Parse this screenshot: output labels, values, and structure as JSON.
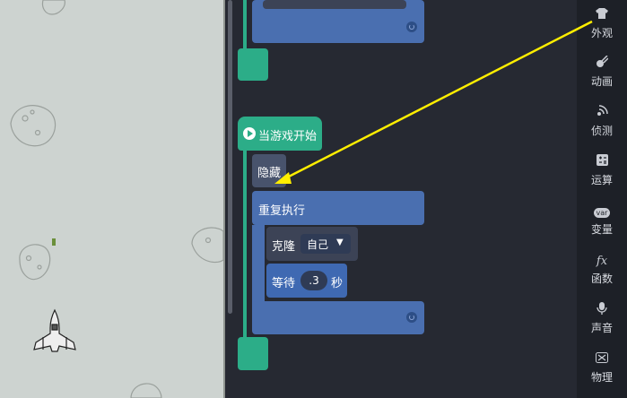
{
  "workspace": {
    "hat_label": "当游戏开始",
    "hide_label": "隐藏",
    "repeat_label": "重复执行",
    "clone_label": "克隆",
    "clone_target": "自己",
    "wait_label": "等待",
    "wait_value": ".3",
    "wait_unit": "秒"
  },
  "sidebar": {
    "items": [
      {
        "label": "外观",
        "icon": "shirt-icon"
      },
      {
        "label": "动画",
        "icon": "comet-icon"
      },
      {
        "label": "侦测",
        "icon": "signal-icon"
      },
      {
        "label": "运算",
        "icon": "calculator-icon"
      },
      {
        "label": "变量",
        "icon": "var-icon"
      },
      {
        "label": "函数",
        "icon": "fx-icon"
      },
      {
        "label": "声音",
        "icon": "microphone-icon"
      },
      {
        "label": "物理",
        "icon": "physics-icon"
      }
    ],
    "var_badge": "var",
    "fx_glyph": "fx"
  },
  "colors": {
    "event": "#2cad88",
    "control": "#4a6fb0",
    "sidebar_bg": "#1d2027",
    "workspace_bg": "#262932",
    "arrow": "#ffee00"
  }
}
